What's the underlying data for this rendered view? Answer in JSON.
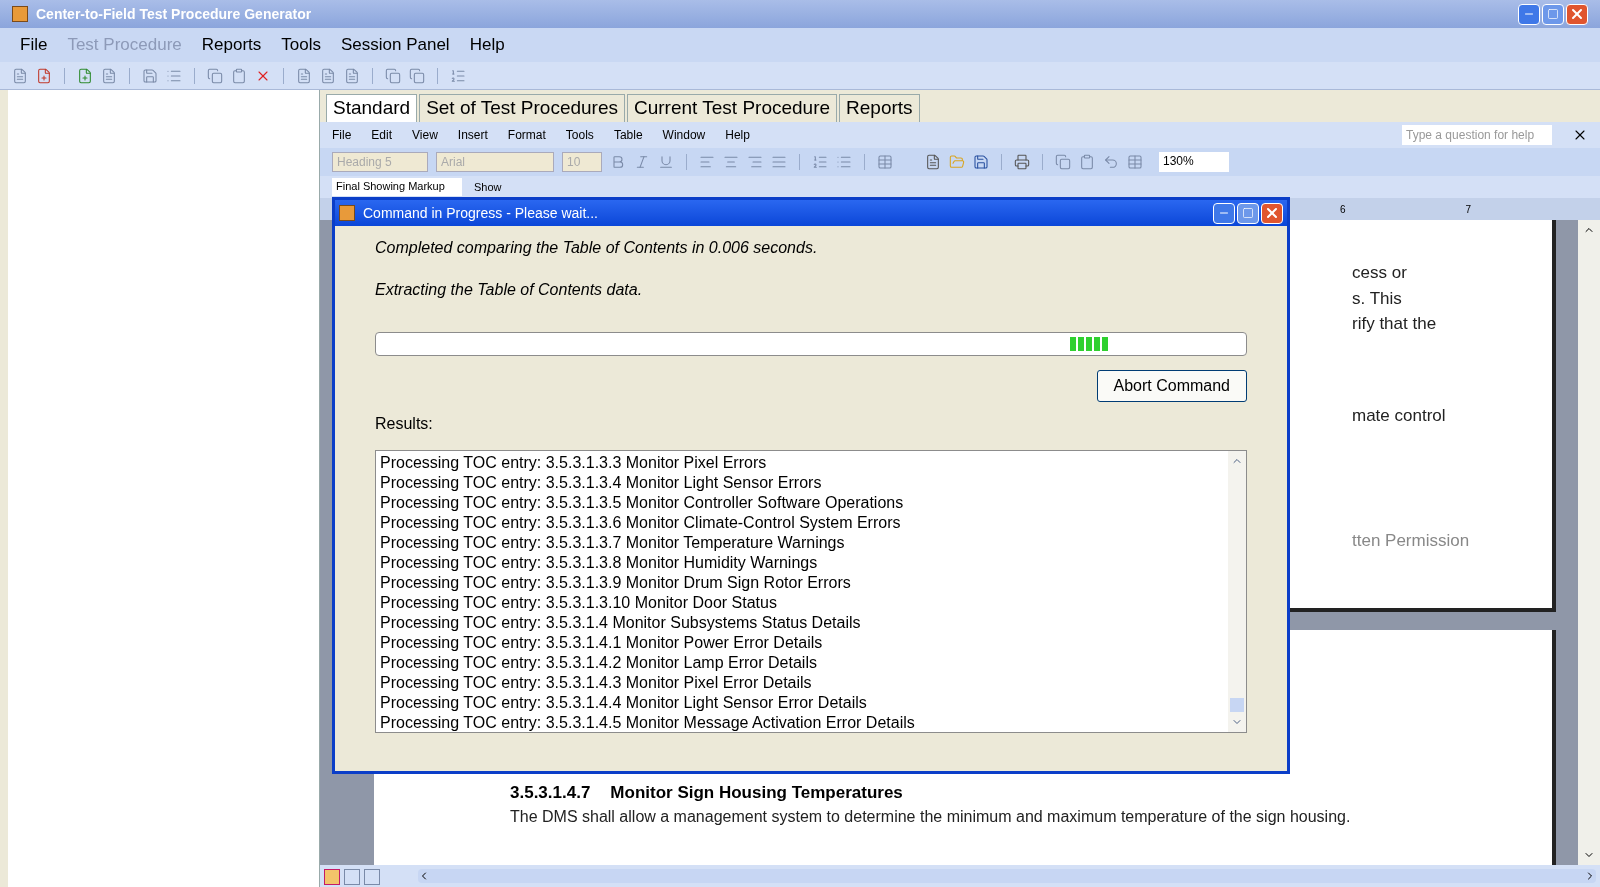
{
  "window": {
    "title": "Center-to-Field Test Procedure Generator"
  },
  "menu": [
    {
      "label": "File",
      "disabled": false
    },
    {
      "label": "Test Procedure",
      "disabled": true
    },
    {
      "label": "Reports",
      "disabled": false
    },
    {
      "label": "Tools",
      "disabled": false
    },
    {
      "label": "Session Panel",
      "disabled": false
    },
    {
      "label": "Help",
      "disabled": false
    }
  ],
  "tabs": [
    {
      "label": "Standard",
      "selected": true
    },
    {
      "label": "Set of Test Procedures",
      "selected": false
    },
    {
      "label": "Current Test Procedure",
      "selected": false
    },
    {
      "label": "Reports",
      "selected": false
    }
  ],
  "word": {
    "menu": [
      "File",
      "Edit",
      "View",
      "Insert",
      "Format",
      "Tools",
      "Table",
      "Window",
      "Help"
    ],
    "help_field": {
      "placeholder": "Type a question for help"
    },
    "style": "Heading 5",
    "font": "Arial",
    "size": "10",
    "zoom": "130%",
    "markup": "Final Showing Markup",
    "show": "Show",
    "ruler": [
      "6",
      "7"
    ]
  },
  "document": {
    "fragments": [
      "cess or",
      "s. This",
      "rify that the",
      "mate control",
      "tten Permission"
    ],
    "heading_number": "3.5.3.1.4.7",
    "heading_title": "Monitor Sign Housing Temperatures",
    "body": "The DMS shall allow a management system to determine the minimum and maximum temperature of the sign housing."
  },
  "dialog": {
    "title": "Command in Progress - Please wait...",
    "messages": [
      "Completed comparing the Table of Contents in 0.006 seconds.",
      "Extracting the Table of Contents data."
    ],
    "button": "Abort Command",
    "results_label": "Results:",
    "results": [
      "Processing TOC entry: 3.5.3.1.3.3 Monitor Pixel Errors",
      "Processing TOC entry: 3.5.3.1.3.4 Monitor Light Sensor Errors",
      "Processing TOC entry: 3.5.3.1.3.5 Monitor Controller Software Operations",
      "Processing TOC entry: 3.5.3.1.3.6 Monitor Climate-Control System Errors",
      "Processing TOC entry: 3.5.3.1.3.7 Monitor Temperature Warnings",
      "Processing TOC entry: 3.5.3.1.3.8 Monitor Humidity Warnings",
      "Processing TOC entry: 3.5.3.1.3.9 Monitor Drum Sign Rotor Errors",
      "Processing TOC entry: 3.5.3.1.3.10 Monitor Door Status",
      "Processing TOC entry: 3.5.3.1.4 Monitor Subsystems Status Details",
      "Processing TOC entry: 3.5.3.1.4.1 Monitor Power Error Details",
      "Processing TOC entry: 3.5.3.1.4.2 Monitor Lamp Error Details",
      "Processing TOC entry: 3.5.3.1.4.3 Monitor Pixel Error Details",
      "Processing TOC entry: 3.5.3.1.4.4 Monitor Light Sensor Error Details",
      "Processing TOC entry: 3.5.3.1.4.5 Monitor Message Activation Error Details"
    ]
  }
}
